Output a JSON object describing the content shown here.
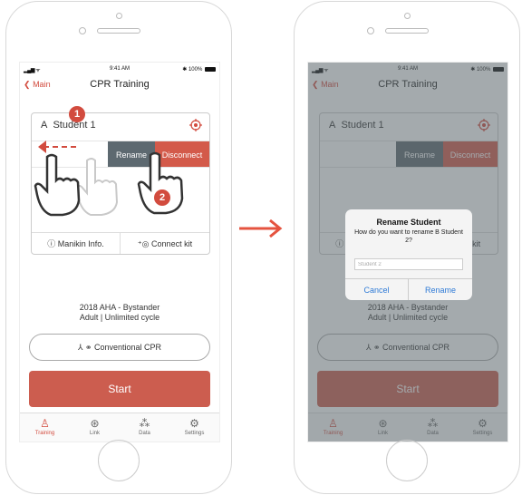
{
  "status": {
    "time": "9:41 AM",
    "battery": "100%"
  },
  "nav": {
    "back_label": "Main",
    "title": "CPR Training"
  },
  "card": {
    "student_prefix": "A",
    "student_name": "Student 1",
    "rename_label": "Rename",
    "disconnect_label": "Disconnect",
    "manikin_info_label": "Manikin Info.",
    "connect_kit_label": "Connect kit"
  },
  "protocol": {
    "line1": "2018 AHA - Bystander",
    "line2": "Adult | Unlimited cycle"
  },
  "cpr_mode_label": "Conventional CPR",
  "start_label": "Start",
  "tabs": [
    {
      "label": "Training",
      "icon": "training-icon"
    },
    {
      "label": "Link",
      "icon": "link-icon"
    },
    {
      "label": "Data",
      "icon": "data-icon"
    },
    {
      "label": "Settings",
      "icon": "settings-icon"
    }
  ],
  "steps": {
    "one": "1",
    "two": "2"
  },
  "dialog": {
    "title": "Rename Student",
    "message": "How do you want to rename B Student 2?",
    "input_placeholder": "Student 2",
    "cancel_label": "Cancel",
    "rename_label": "Rename"
  },
  "colors": {
    "accent": "#d24b3e",
    "rename_bg": "#5d6970",
    "disconnect_bg": "#d35a4a",
    "start_bg": "#cc5d4f",
    "dialog_link": "#2e7ad6"
  }
}
